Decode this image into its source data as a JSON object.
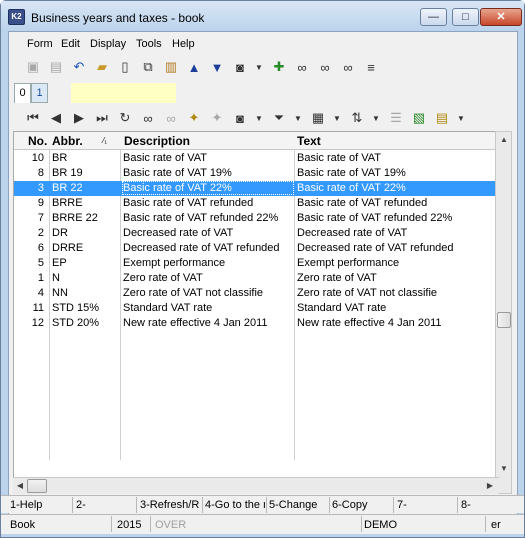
{
  "window": {
    "title": "Business years and taxes - book",
    "app_icon_text": "K2",
    "controls": {
      "minimize": "—",
      "maximize": "□",
      "close": "✕"
    }
  },
  "menu": [
    "Form",
    "Edit",
    "Display",
    "Tools",
    "Help"
  ],
  "toolbar1_icons": [
    "save-icon",
    "save-all-icon",
    "undo-icon",
    "open-folder-icon",
    "new-document-icon",
    "copy-icon",
    "book-icon",
    "arrow-up-icon",
    "arrow-down-icon",
    "camera-icon",
    "dropdown-icon",
    "add-record-icon",
    "binoculars-icon",
    "binoculars-filter-icon",
    "binoculars-next-icon",
    "menu-lines-icon"
  ],
  "tabs": [
    {
      "label": "0"
    },
    {
      "label": "1"
    }
  ],
  "toolbar2_icons": [
    "first-record-icon",
    "prev-record-icon",
    "next-record-icon",
    "last-record-icon",
    "refresh-icon",
    "binoculars-icon",
    "binoculars-disabled-icon",
    "add-icon",
    "add-disabled-icon",
    "camera-icon",
    "filter-icon",
    "columns-icon",
    "sort-icon",
    "group-icon",
    "excel-icon",
    "report-icon"
  ],
  "grid": {
    "columns": {
      "no": "No.",
      "abbr": "Abbr.",
      "sort_indicator": "⁄₁",
      "description": "Description",
      "text": "Text"
    },
    "rows": [
      {
        "no": "10",
        "abbr": "BR",
        "description": "Basic rate of VAT",
        "text": "Basic rate of VAT"
      },
      {
        "no": "8",
        "abbr": "BR 19",
        "description": "Basic rate of VAT 19%",
        "text": "Basic rate of VAT 19%"
      },
      {
        "no": "3",
        "abbr": "BR 22",
        "description": "Basic rate of VAT 22%",
        "text": "Basic rate of VAT 22%",
        "selected": true
      },
      {
        "no": "9",
        "abbr": "BRRE",
        "description": "Basic rate of VAT refunded",
        "text": "Basic rate of VAT refunded"
      },
      {
        "no": "7",
        "abbr": "BRRE 22",
        "description": "Basic rate of VAT refunded 22%",
        "text": "Basic rate of VAT refunded 22%"
      },
      {
        "no": "2",
        "abbr": "DR",
        "description": "Decreased rate of VAT",
        "text": "Decreased rate of VAT"
      },
      {
        "no": "6",
        "abbr": "DRRE",
        "description": "Decreased rate of VAT refunded",
        "text": "Decreased rate of VAT refunded"
      },
      {
        "no": "5",
        "abbr": "EP",
        "description": "Exempt performance",
        "text": "Exempt performance"
      },
      {
        "no": "1",
        "abbr": "N",
        "description": "Zero rate of VAT",
        "text": "Zero rate of VAT"
      },
      {
        "no": "4",
        "abbr": "NN",
        "description": "Zero rate of VAT not classifie",
        "text": "Zero rate of VAT not classifie"
      },
      {
        "no": "11",
        "abbr": "STD 15%",
        "description": "Standard VAT rate",
        "text": "Standard VAT rate"
      },
      {
        "no": "12",
        "abbr": "STD 20%",
        "description": "New rate effective 4 Jan 2011",
        "text": "New rate effective 4 Jan 2011"
      }
    ]
  },
  "function_keys": [
    "1-Help",
    "2-",
    "3-Refresh/R",
    "4-Go to the r",
    "5-Change",
    "6-Copy",
    "7-",
    "8-"
  ],
  "status": {
    "book": "Book",
    "year": "2015",
    "over": "OVER",
    "mode": "DEMO",
    "lang": "er"
  },
  "colors": {
    "selection": "#3399ff",
    "tab_field": "#ffffc4",
    "title_bar": "#bcd3ec"
  }
}
